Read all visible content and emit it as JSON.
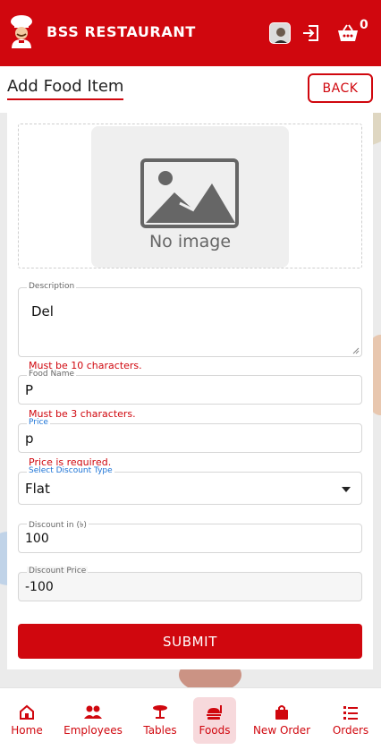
{
  "header": {
    "app_title": "BSS RESTAURANT",
    "cart_count": "0",
    "brand_color": "#d0070e",
    "icons": [
      "chef-logo-icon",
      "avatar",
      "logout-icon",
      "cart-basket-icon"
    ]
  },
  "page": {
    "title": "Add Food Item",
    "back_label": "BACK"
  },
  "image_upload": {
    "placeholder_text": "No image"
  },
  "form": {
    "description": {
      "label": "Description",
      "value": "Del",
      "error": "Must be 10 characters."
    },
    "food_name": {
      "label": "Food Name",
      "value": "P",
      "error": "Must be 3 characters."
    },
    "price": {
      "label": "Price",
      "value": "p",
      "error": "Price is required."
    },
    "discount_type": {
      "label": "Select Discount Type",
      "value": "Flat"
    },
    "discount_in": {
      "label": "Discount in (৳)",
      "value": "100"
    },
    "discount_price": {
      "label": "Discount Price",
      "value": "-100"
    },
    "submit_label": "SUBMIT",
    "error_color": "#d0070e"
  },
  "bottom_nav": {
    "items": [
      {
        "label": "Home",
        "icon": "home-icon"
      },
      {
        "label": "Employees",
        "icon": "people-icon"
      },
      {
        "label": "Tables",
        "icon": "table-icon"
      },
      {
        "label": "Foods",
        "icon": "food-icon",
        "active": true
      },
      {
        "label": "New Order",
        "icon": "shopping-bag-icon"
      },
      {
        "label": "Orders",
        "icon": "list-icon"
      }
    ]
  }
}
